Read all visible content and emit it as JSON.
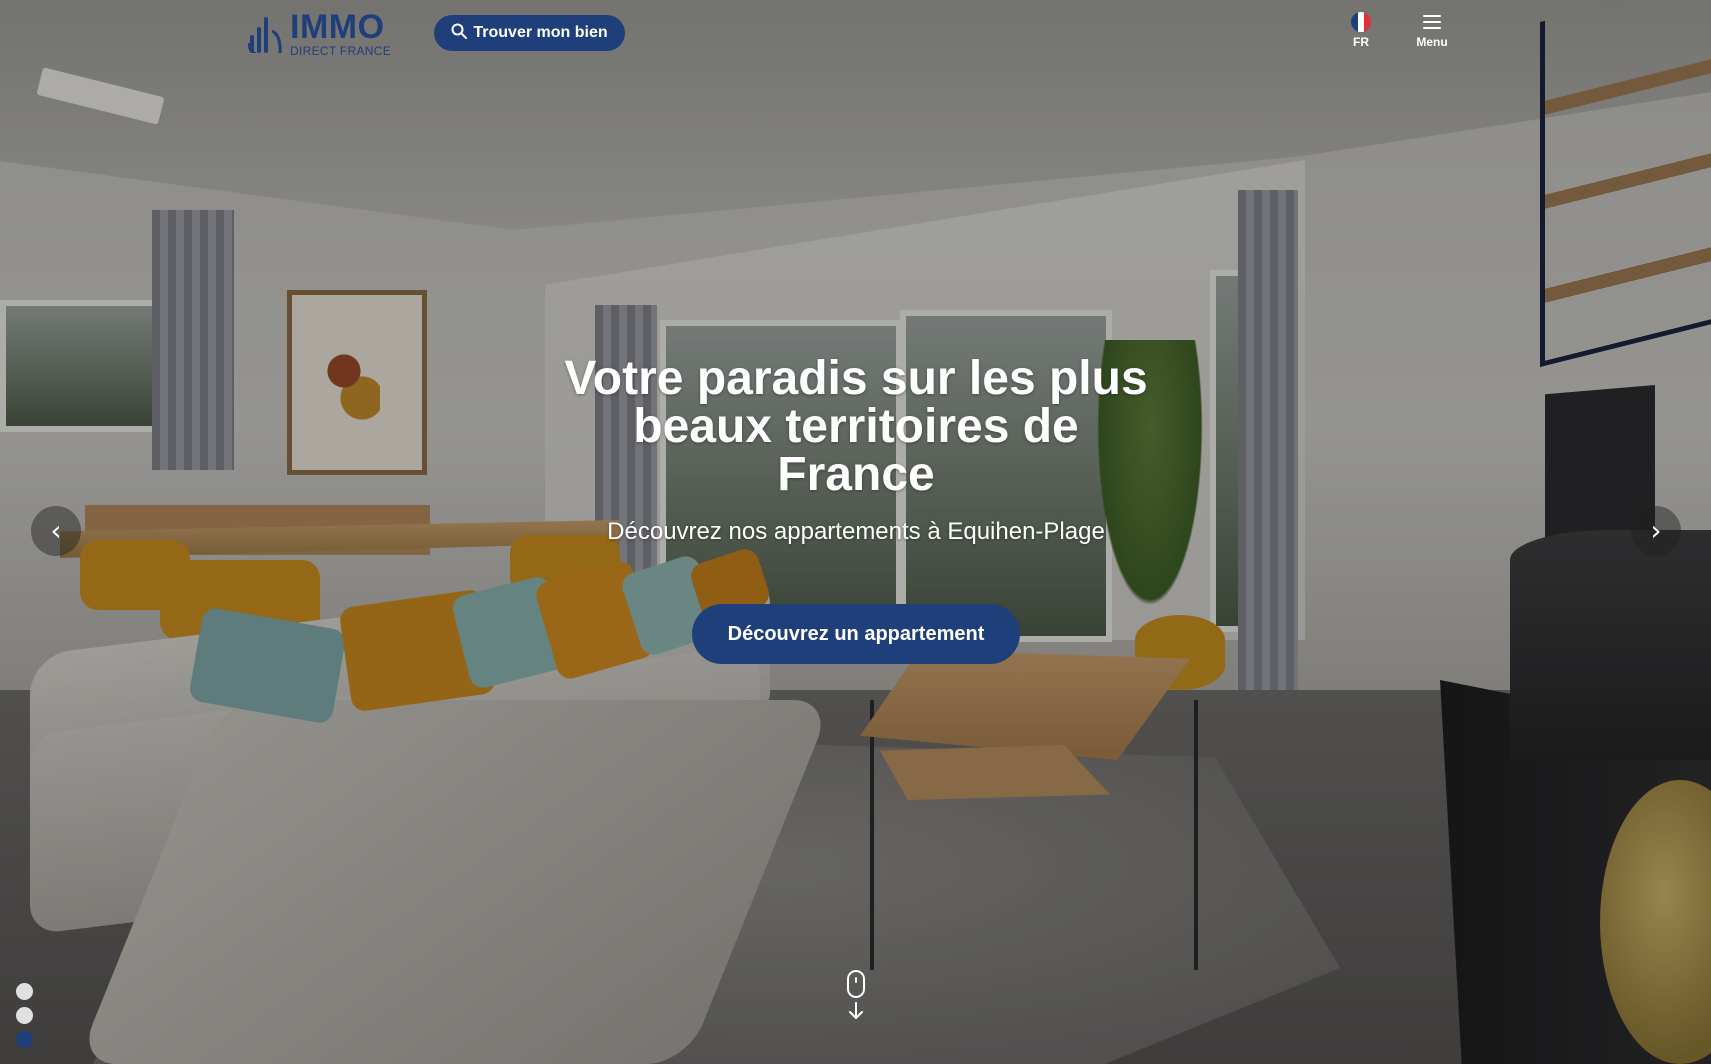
{
  "brand": {
    "name": "IMMO",
    "tagline": "DIRECT FRANCE",
    "color": "#1f3f7a"
  },
  "header": {
    "search_button_label": "Trouver mon bien",
    "search_icon": "search-icon",
    "language": {
      "label": "FR",
      "flag_icon": "france-flag-icon",
      "flag_colors": [
        "#1f3f7a",
        "#ffffff",
        "#e0303a"
      ]
    },
    "menu": {
      "label": "Menu",
      "icon": "hamburger-icon"
    }
  },
  "hero": {
    "title": "Votre paradis sur les plus beaux territoires de France",
    "subtitle": "Découvrez nos appartements à Equihen-Plage",
    "cta_label": "Découvrez un appartement",
    "prev_label": "‹",
    "next_label": "›",
    "scroll_icon": "mouse-scroll-icon"
  },
  "carousel": {
    "slides_count": 3,
    "active_index": 2
  }
}
